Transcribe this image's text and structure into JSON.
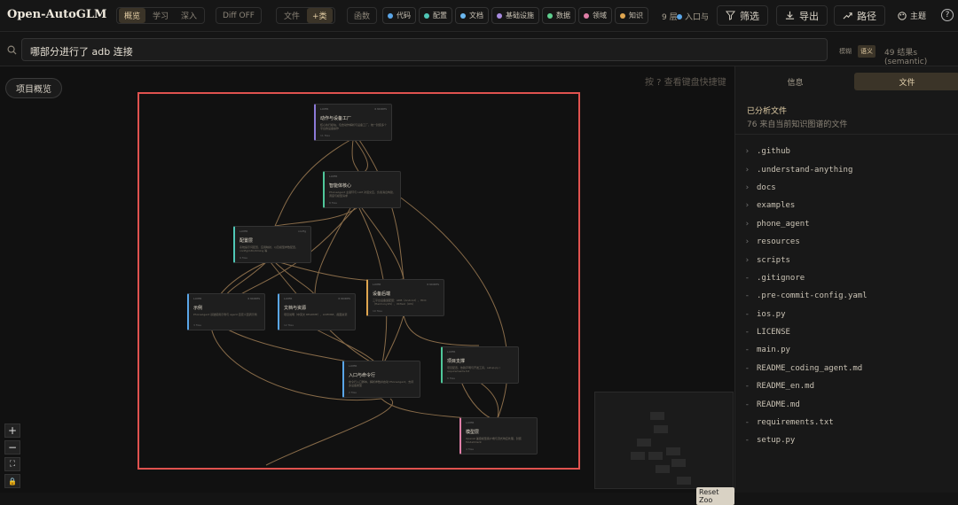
{
  "app": {
    "title": "Open-AutoGLM"
  },
  "header": {
    "view_modes": [
      {
        "label": "概览",
        "active": true
      },
      {
        "label": "学习",
        "active": false
      },
      {
        "label": "深入",
        "active": false
      }
    ],
    "diff_label": "Diff OFF",
    "source_modes": [
      {
        "label": "文件",
        "active": false
      },
      {
        "label": "+类",
        "active": true
      }
    ],
    "func_label": "函数",
    "filters": [
      {
        "label": "代码",
        "color": "#5aa6e8"
      },
      {
        "label": "配置",
        "color": "#4fc7b6"
      },
      {
        "label": "文档",
        "color": "#6bb8f0"
      },
      {
        "label": "基础设施",
        "color": "#a88be0"
      },
      {
        "label": "数据",
        "color": "#5fcf8e"
      },
      {
        "label": "领域",
        "color": "#e07fa8"
      },
      {
        "label": "知识",
        "color": "#e0a64f"
      }
    ],
    "layers": "9 层",
    "indegree": "入口与",
    "filter_btn": "筛选",
    "export_btn": "导出",
    "path_btn": "路径",
    "theme_btn": "主题",
    "help": "?"
  },
  "search": {
    "value": "哪部分进行了 adb 连接",
    "modes": [
      {
        "label": "模糊",
        "active": false
      },
      {
        "label": "语义",
        "active": true
      }
    ],
    "results": "49 结果s (semantic)"
  },
  "canvas": {
    "overview_btn": "项目概览",
    "shortcut_hint": "按 ? 查看键盘快捷键",
    "zoom_in": "+",
    "zoom_out": "−",
    "fit": "⛶",
    "lock": "🔒",
    "reset_tooltip": "Reset Zoo",
    "nodes": [
      {
        "title": "动作与设备工厂",
        "tag": "LAYER",
        "tag2": "6 NODES",
        "desc": "核心执行模块，包含动作解析与设备工厂，统一封装多个平台的设备操作",
        "foot": "11 files",
        "color": "#8c7ad8"
      },
      {
        "title": "智能体核心",
        "tag": "LAYER",
        "tag2": "",
        "desc": "PhoneAgent 主循环与 LLM 对话交互，负责消息构建、调度与模型请求",
        "foot": "8 files",
        "color": "#4fc79a"
      },
      {
        "title": "配置层",
        "tag": "LAYER",
        "tag2": "config",
        "desc": "系统提示词配置、应用映射、以及模型参数配置，config/i18n/timing 等",
        "foot": "9 files",
        "color": "#4fc7b6"
      },
      {
        "title": "示例",
        "tag": "LAYER",
        "tag2": "6 NODES",
        "desc": "PhoneAgent 基础使用示例与 agent 自定义回调示例",
        "foot": "3 files",
        "color": "#5aa6e8"
      },
      {
        "title": "文档与资源",
        "tag": "LAYER",
        "tag2": "6 NODES",
        "desc": "项目说明（中英文 README）、LICENSE、截图资源",
        "foot": "12 files",
        "color": "#5aa6e8"
      },
      {
        "title": "设备后端",
        "tag": "LAYER",
        "tag2": "6 NODES",
        "desc": "三平台设备适配层：ADB（Android）、HDC（HarmonyOS）、XCTest（iOS）",
        "foot": "10 files",
        "color": "#e0a64f"
      },
      {
        "title": "项目支撑",
        "tag": "LAYER",
        "tag2": "",
        "desc": "项目配置、依赖声明与开发工具，setup.py / requirements.txt",
        "foot": "6 files",
        "color": "#4fc79a"
      },
      {
        "title": "入口与命令行",
        "tag": "LAYER",
        "tag2": "",
        "desc": "命令行入口脚本，解析参数并启动 PhoneAgent，支持多设备类型",
        "foot": "2 files",
        "color": "#5aa6e8"
      },
      {
        "title": "模型层",
        "tag": "LAYER",
        "tag2": "",
        "desc": "OpenAI 兼容模型客户端与流式响应处理，封装 ModelClient",
        "foot": "4 files",
        "color": "#e07fa8"
      }
    ]
  },
  "panel": {
    "tabs": [
      {
        "label": "信息",
        "active": false
      },
      {
        "label": "文件",
        "active": true
      }
    ],
    "title": "已分析文件",
    "subtitle": "76 来自当前知识图谱的文件",
    "files": [
      {
        "name": ".github",
        "type": "folder"
      },
      {
        "name": ".understand-anything",
        "type": "folder"
      },
      {
        "name": "docs",
        "type": "folder"
      },
      {
        "name": "examples",
        "type": "folder"
      },
      {
        "name": "phone_agent",
        "type": "folder"
      },
      {
        "name": "resources",
        "type": "folder"
      },
      {
        "name": "scripts",
        "type": "folder"
      },
      {
        "name": ".gitignore",
        "type": "file"
      },
      {
        "name": ".pre-commit-config.yaml",
        "type": "file"
      },
      {
        "name": "ios.py",
        "type": "file"
      },
      {
        "name": "LICENSE",
        "type": "file"
      },
      {
        "name": "main.py",
        "type": "file"
      },
      {
        "name": "README_coding_agent.md",
        "type": "file"
      },
      {
        "name": "README_en.md",
        "type": "file"
      },
      {
        "name": "README.md",
        "type": "file"
      },
      {
        "name": "requirements.txt",
        "type": "file"
      },
      {
        "name": "setup.py",
        "type": "file"
      }
    ]
  },
  "colors": {
    "accent": "#e3cda4",
    "highlight": "#e0524f",
    "edge": "#b08a5c"
  }
}
